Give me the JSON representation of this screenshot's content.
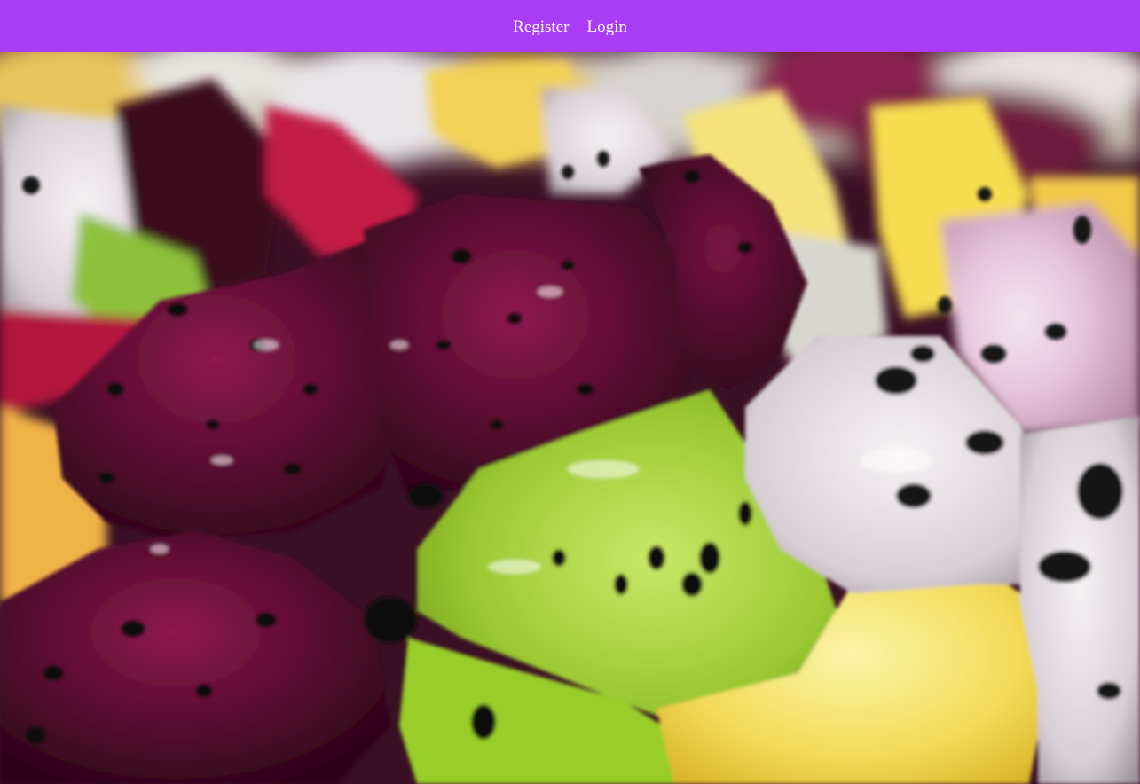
{
  "nav": {
    "background": "#ab3cf5",
    "links": [
      {
        "label": "Register"
      },
      {
        "label": "Login"
      }
    ]
  },
  "hero": {
    "image": "fruit-salad-photo",
    "colors": {
      "dragonfruit_red": "#6a0f3a",
      "dragonfruit_white": "#ece6ea",
      "kiwi": "#a8d640",
      "pineapple": "#f5d84a",
      "seed": "#121212"
    }
  }
}
